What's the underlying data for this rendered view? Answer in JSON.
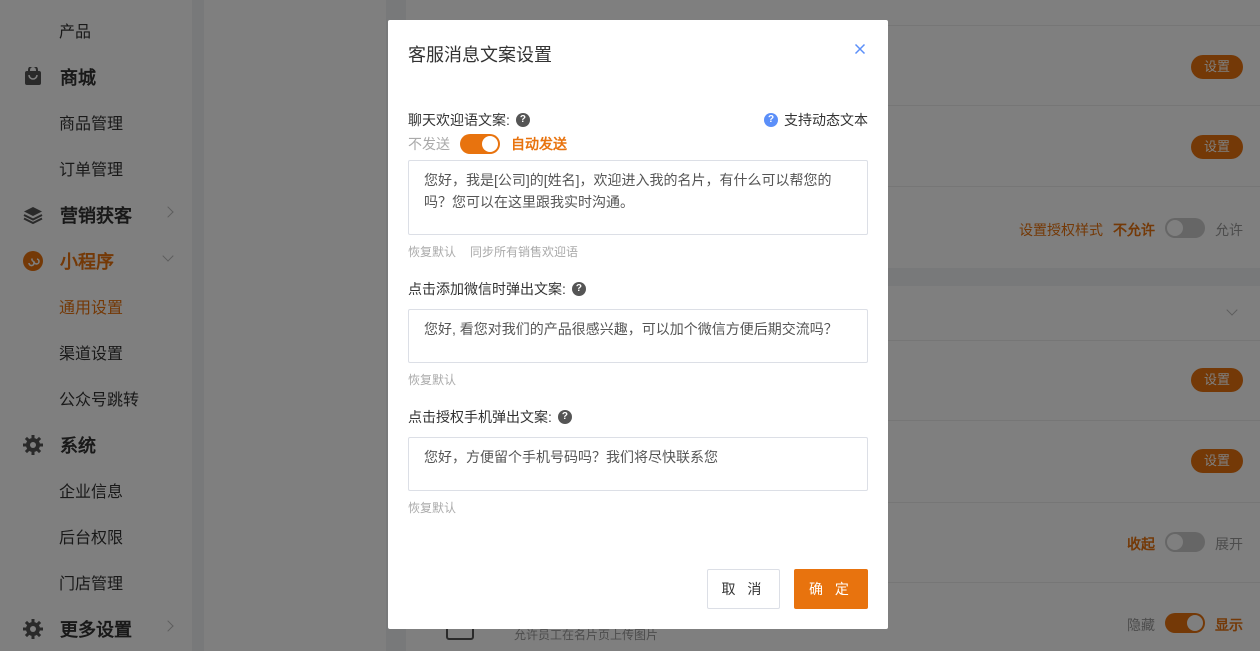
{
  "sidebar": {
    "items": [
      {
        "type": "sub",
        "label": "产品"
      },
      {
        "type": "group",
        "label": "商城",
        "icon": "bag-icon"
      },
      {
        "type": "sub",
        "label": "商品管理"
      },
      {
        "type": "sub",
        "label": "订单管理"
      },
      {
        "type": "group",
        "label": "营销获客",
        "icon": "layers-icon"
      },
      {
        "type": "group",
        "label": "小程序",
        "icon": "miniprogram-icon",
        "active": true
      },
      {
        "type": "sub",
        "label": "通用设置",
        "active": true
      },
      {
        "type": "sub",
        "label": "渠道设置"
      },
      {
        "type": "sub",
        "label": "公众号跳转"
      },
      {
        "type": "group",
        "label": "系统",
        "icon": "gear-icon"
      },
      {
        "type": "sub",
        "label": "企业信息"
      },
      {
        "type": "sub",
        "label": "后台权限"
      },
      {
        "type": "sub",
        "label": "门店管理"
      },
      {
        "type": "group",
        "label": "更多设置",
        "icon": "gear-icon"
      }
    ]
  },
  "background": {
    "set_button_label": "设置",
    "auth_style_label": "设置授权样式",
    "not_allow": "不允许",
    "allow": "允许",
    "collapse": "收起",
    "expand": "展开",
    "hide": "隐藏",
    "show": "显示",
    "upload_desc": "允许员工在名片页上传图片"
  },
  "modal": {
    "title": "客服消息文案设置",
    "dynamic_text_hint": "支持动态文本",
    "welcome": {
      "label": "聊天欢迎语文案:",
      "toggle_off_label": "不发送",
      "toggle_on_label": "自动发送",
      "toggle_on": true,
      "text": "您好，我是[公司]的[姓名]，欢迎进入我的名片，有什么可以帮您的吗？您可以在这里跟我实时沟通。",
      "restore": "恢复默认",
      "sync": "同步所有销售欢迎语"
    },
    "wechat": {
      "label": "点击添加微信时弹出文案:",
      "text": "您好, 看您对我们的产品很感兴趣，可以加个微信方便后期交流吗？",
      "restore": "恢复默认"
    },
    "phone": {
      "label": "点击授权手机弹出文案:",
      "text": "您好，方便留个手机号码吗？我们将尽快联系您",
      "restore": "恢复默认"
    },
    "cancel_label": "取 消",
    "confirm_label": "确 定"
  }
}
